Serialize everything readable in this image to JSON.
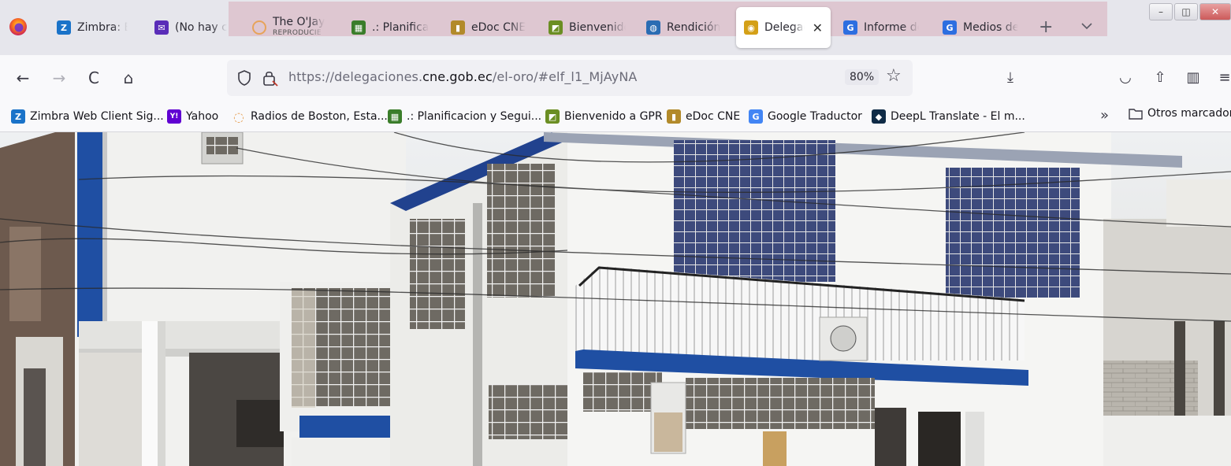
{
  "tabs": [
    {
      "title": "Zimbra: En",
      "icon": "zimbra-icon",
      "color": "#1a73c9"
    },
    {
      "title": "(No hay co",
      "icon": "mail-icon",
      "color": "#5a2db8"
    },
    {
      "title": "The O'Jays",
      "subtitle": "REPRODUCIE",
      "icon": "radio-icon",
      "color": "#e7a35a"
    },
    {
      "title": ".: Planificac",
      "icon": "planificacion-icon",
      "color": "#3a7d2a"
    },
    {
      "title": "eDoc CNE",
      "icon": "edoc-icon",
      "color": "#b28a2a"
    },
    {
      "title": "Bienvenido",
      "icon": "gpr-icon",
      "color": "#6b8e23"
    },
    {
      "title": "Rendición",
      "icon": "rendicion-icon",
      "color": "#2a6cb3"
    },
    {
      "title": "Delegac",
      "icon": "delegacion-icon",
      "color": "#d4a017",
      "active": true
    },
    {
      "title": "Informe de",
      "icon": "google-icon",
      "color": "#2d6ee0"
    },
    {
      "title": "Medios de",
      "icon": "google-icon",
      "color": "#2d6ee0"
    }
  ],
  "tab_close_glyph": "✕",
  "newtab_glyph": "+",
  "window": {
    "minimize": "–",
    "maximize": "◫",
    "close": "✕"
  },
  "nav": {
    "back": "←",
    "forward": "→",
    "reload": "C",
    "home": "⌂",
    "url_prefix": "https://delegaciones.",
    "url_domain": "cne.gob.ec",
    "url_suffix": "/el-oro/#elf_l1_MjAyNA",
    "zoom": "80%",
    "star": "☆",
    "download": "⤓",
    "pocket": "◡",
    "share": "⇧",
    "sidebar": "▥",
    "menu": "≡"
  },
  "bookmarks": [
    {
      "label": "Zimbra Web Client Sig...",
      "icon": "zimbra-icon",
      "color": "#1a73c9",
      "glyph": "Z"
    },
    {
      "label": "Yahoo",
      "icon": "yahoo-icon",
      "color": "#6001d2",
      "glyph": "Y!"
    },
    {
      "label": "Radios de Boston, Esta...",
      "icon": "radio-icon",
      "color": "#e7a35a",
      "glyph": "◌"
    },
    {
      "label": ".: Planificacion y Segui...",
      "icon": "planificacion-icon",
      "color": "#3a7d2a",
      "glyph": "▦"
    },
    {
      "label": "Bienvenido a GPR",
      "icon": "gpr-icon",
      "color": "#6b8e23",
      "glyph": "◩"
    },
    {
      "label": "eDoc CNE",
      "icon": "edoc-icon",
      "color": "#b28a2a",
      "glyph": "▮"
    },
    {
      "label": "Google Traductor",
      "icon": "translate-icon",
      "color": "#4285f4",
      "glyph": "G"
    },
    {
      "label": "DeepL Translate - El m...",
      "icon": "deepl-icon",
      "color": "#0f2b46",
      "glyph": "◆"
    }
  ],
  "bookmarks_overflow": "»",
  "other_bookmarks": "Otros marcadores",
  "colors": {
    "accent_blue": "#1f4fa3",
    "building_white": "#f2f2f2",
    "window_blue": "#3c4f8e"
  }
}
